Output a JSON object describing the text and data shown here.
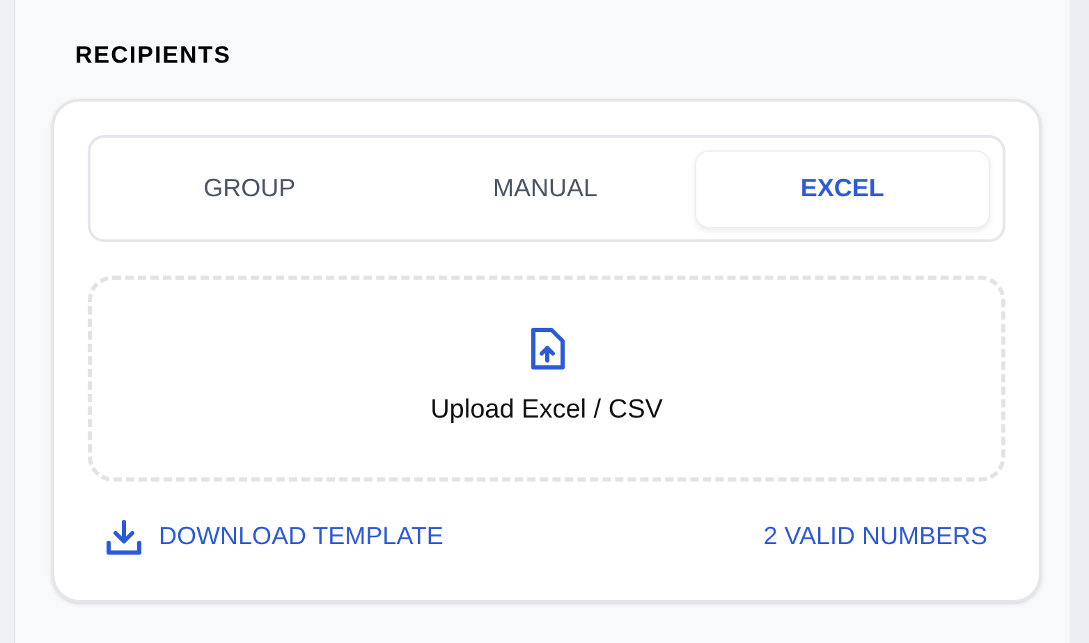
{
  "section": {
    "title": "RECIPIENTS"
  },
  "tabs": [
    {
      "label": "GROUP",
      "selected": false
    },
    {
      "label": "MANUAL",
      "selected": false
    },
    {
      "label": "EXCEL",
      "selected": true
    }
  ],
  "upload": {
    "label": "Upload Excel / CSV"
  },
  "download_link": {
    "label": "DOWNLOAD TEMPLATE"
  },
  "valid_count": "2 VALID NUMBERS"
}
